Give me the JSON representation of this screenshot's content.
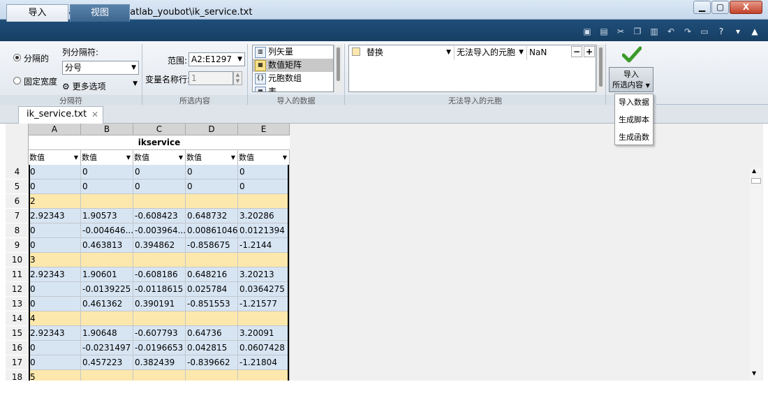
{
  "window": {
    "title": "导入 - D:\\matlab_work\\matlab_youbot\\ik_service.txt",
    "min_label": "▁",
    "max_label": "▢",
    "close_label": "X"
  },
  "tabs": {
    "import": "导入",
    "view": "视图"
  },
  "quick_icons": [
    "new-icon",
    "save-icon",
    "cut-icon",
    "copy-icon",
    "paste-icon",
    "undo-icon",
    "redo-icon",
    "window-icon",
    "help-icon",
    "menu-icon",
    "collapse-icon"
  ],
  "delimiter": {
    "option_delimited": "分隔的",
    "option_fixed": "固定宽度",
    "column_sep_label": "列分隔符:",
    "column_sep_value": "分号",
    "more_options": "更多选项",
    "group_label": "分隔符"
  },
  "selection": {
    "range_label": "范围:",
    "range_value": "A2:E1297",
    "varrow_label": "变量名称行:",
    "varrow_value": "1",
    "group_label": "所选内容"
  },
  "output_type": {
    "items": [
      "列矢量",
      "数值矩阵",
      "元胞数组",
      "表"
    ],
    "selected_index": 1,
    "group_label": "导入的数据"
  },
  "unimportable": {
    "action": "替换",
    "target": "无法导入的元胞",
    "value": "NaN",
    "minus": "−",
    "plus": "+",
    "group_label": "无法导入的元胞"
  },
  "import_button": {
    "line1": "导入",
    "line2": "所选内容"
  },
  "import_menu": [
    "导入数据",
    "生成脚本",
    "生成函数"
  ],
  "document_tab": {
    "label": "ik_service.txt"
  },
  "grid": {
    "columns": [
      "A",
      "B",
      "C",
      "D",
      "E"
    ],
    "variable_name": "ikservice",
    "column_type": "数值",
    "rows": [
      {
        "num": "4",
        "cells": [
          "0",
          "0",
          "0",
          "0",
          "0"
        ],
        "style": "blue"
      },
      {
        "num": "5",
        "cells": [
          "0",
          "0",
          "0",
          "0",
          "0"
        ],
        "style": "blue"
      },
      {
        "num": "6",
        "cells": [
          "2",
          "",
          "",
          "",
          ""
        ],
        "style": "yellow"
      },
      {
        "num": "7",
        "cells": [
          "2.92343",
          "1.90573",
          "-0.608423",
          "0.648732",
          "3.20286"
        ],
        "style": "blue"
      },
      {
        "num": "8",
        "cells": [
          "0",
          "-0.004646...",
          "-0.003964...",
          "0.00861046",
          "0.0121394"
        ],
        "style": "blue"
      },
      {
        "num": "9",
        "cells": [
          "0",
          "0.463813",
          "0.394862",
          "-0.858675",
          "-1.2144"
        ],
        "style": "blue"
      },
      {
        "num": "10",
        "cells": [
          "3",
          "",
          "",
          "",
          ""
        ],
        "style": "yellow"
      },
      {
        "num": "11",
        "cells": [
          "2.92343",
          "1.90601",
          "-0.608186",
          "0.648216",
          "3.20213"
        ],
        "style": "blue"
      },
      {
        "num": "12",
        "cells": [
          "0",
          "-0.0139225",
          "-0.0118615",
          "0.025784",
          "0.0364275"
        ],
        "style": "blue"
      },
      {
        "num": "13",
        "cells": [
          "0",
          "0.461362",
          "0.390191",
          "-0.851553",
          "-1.21577"
        ],
        "style": "blue"
      },
      {
        "num": "14",
        "cells": [
          "4",
          "",
          "",
          "",
          ""
        ],
        "style": "yellow"
      },
      {
        "num": "15",
        "cells": [
          "2.92343",
          "1.90648",
          "-0.607793",
          "0.64736",
          "3.20091"
        ],
        "style": "blue"
      },
      {
        "num": "16",
        "cells": [
          "0",
          "-0.0231497",
          "-0.0196653",
          "0.042815",
          "0.0607428"
        ],
        "style": "blue"
      },
      {
        "num": "17",
        "cells": [
          "0",
          "0.457223",
          "0.382439",
          "-0.839662",
          "-1.21804"
        ],
        "style": "blue"
      },
      {
        "num": "18",
        "cells": [
          "5",
          "",
          "",
          "",
          ""
        ],
        "style": "yellow"
      }
    ]
  },
  "colors": {
    "ribbon_tab_bg": "#1f4e79",
    "cell_blue": "#d7e5f3",
    "cell_yellow": "#fce8ad"
  }
}
